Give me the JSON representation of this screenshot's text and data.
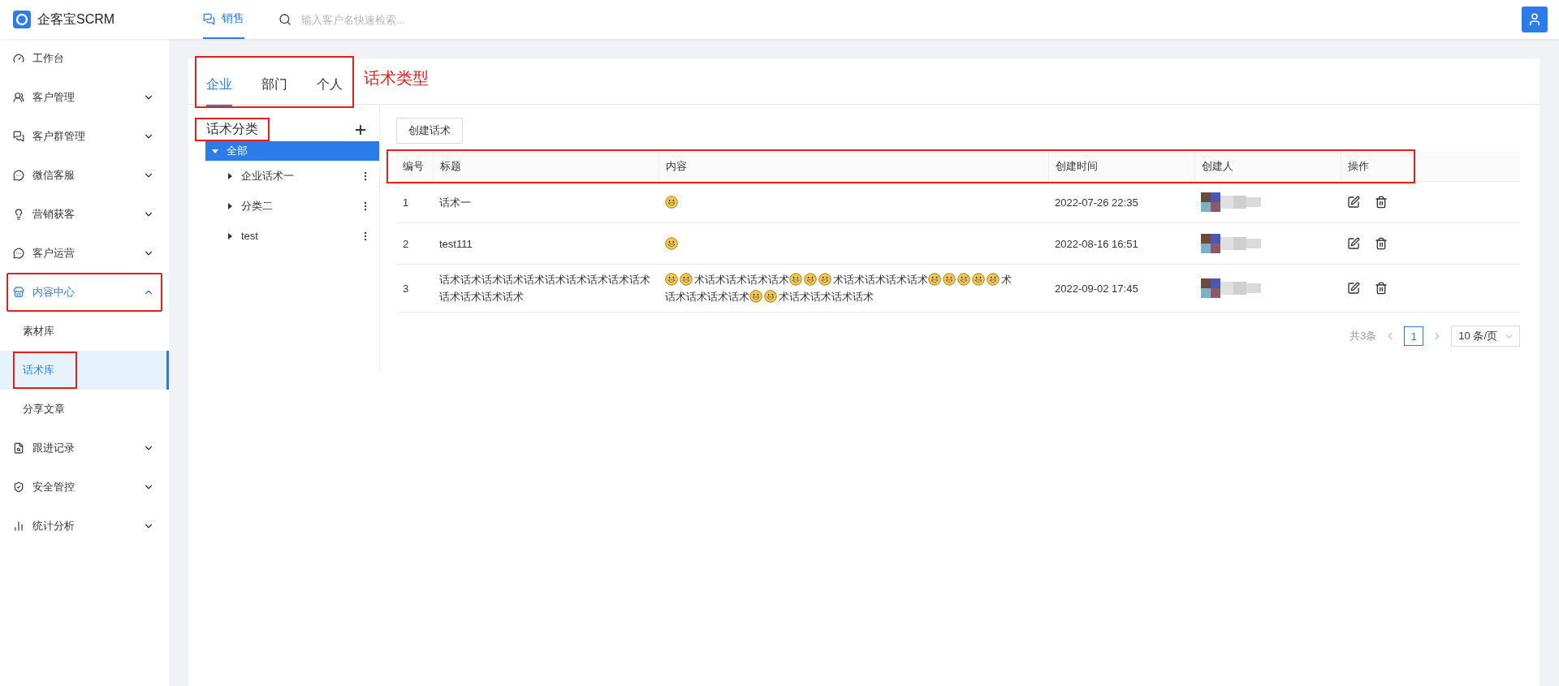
{
  "brand": {
    "name": "企客宝SCRM"
  },
  "top_nav": {
    "tabs": [
      {
        "label": "销售",
        "selected": true
      }
    ],
    "search": {
      "placeholder": "输入客户名快速检索..."
    }
  },
  "sidebar": {
    "items": [
      {
        "label": "工作台",
        "kind": "link",
        "selected": false,
        "highlighted": false
      },
      {
        "label": "客户管理",
        "kind": "group",
        "expanded": false,
        "selected": false,
        "highlighted": false
      },
      {
        "label": "客户群管理",
        "kind": "group",
        "expanded": false,
        "selected": false,
        "highlighted": false
      },
      {
        "label": "微信客服",
        "kind": "group",
        "expanded": false,
        "selected": false,
        "highlighted": false
      },
      {
        "label": "营销获客",
        "kind": "group",
        "expanded": false,
        "selected": false,
        "highlighted": false
      },
      {
        "label": "客户运营",
        "kind": "group",
        "expanded": false,
        "selected": false,
        "highlighted": false
      },
      {
        "label": "内容中心",
        "kind": "group",
        "expanded": true,
        "selected": true,
        "highlighted": true,
        "children": [
          {
            "label": "素材库",
            "selected": false,
            "highlighted": false
          },
          {
            "label": "话术库",
            "selected": true,
            "highlighted": true
          },
          {
            "label": "分享文章",
            "selected": false,
            "highlighted": false
          }
        ]
      },
      {
        "label": "跟进记录",
        "kind": "group",
        "expanded": false,
        "selected": false,
        "highlighted": false
      },
      {
        "label": "安全管控",
        "kind": "group",
        "expanded": false,
        "selected": false,
        "highlighted": false
      },
      {
        "label": "统计分析",
        "kind": "group",
        "expanded": false,
        "selected": false,
        "highlighted": false
      }
    ]
  },
  "type_tabs": {
    "highlighted": true,
    "annotation": "话术类型",
    "tabs": [
      {
        "label": "企业",
        "selected": true
      },
      {
        "label": "部门",
        "selected": false
      },
      {
        "label": "个人",
        "selected": false
      }
    ]
  },
  "category_tree": {
    "title": "话术分类",
    "highlighted": true,
    "nodes": [
      {
        "label": "全部",
        "selected": true,
        "expanded": true,
        "children": [
          {
            "label": "企业话术一",
            "selected": false,
            "expanded": false
          },
          {
            "label": "分类二",
            "selected": false,
            "expanded": false
          },
          {
            "label": "test",
            "selected": false,
            "expanded": false
          }
        ]
      }
    ]
  },
  "create_button": "创建话术",
  "table": {
    "header_highlighted": true,
    "columns": [
      "编号",
      "标题",
      "内容",
      "创建时间",
      "创建人",
      "操作"
    ],
    "rows": [
      {
        "id": "1",
        "title": "话术一",
        "content": [
          {
            "kind": "grin"
          }
        ],
        "created": "2022-07-26 22:35"
      },
      {
        "id": "2",
        "title": "test111",
        "content": [
          {
            "kind": "grin"
          }
        ],
        "created": "2022-08-16 16:51"
      },
      {
        "id": "3",
        "title": "话术话术话术话术话术话术话术话术话术话术话术话术话术话术",
        "content": [
          {
            "kind": "grin"
          },
          {
            "kind": "sweat"
          },
          {
            "kind": "text",
            "text": "术话术话术话术话术"
          },
          {
            "kind": "grin"
          },
          {
            "kind": "sweat"
          },
          {
            "kind": "grin"
          },
          {
            "kind": "text",
            "text": "术话术话术话术话术"
          },
          {
            "kind": "sweat"
          },
          {
            "kind": "grin"
          },
          {
            "kind": "sweat"
          },
          {
            "kind": "grin"
          },
          {
            "kind": "sweat"
          },
          {
            "kind": "text",
            "text": "术"
          },
          {
            "kind": "text",
            "text": "话术话术话术话术"
          },
          {
            "kind": "grin"
          },
          {
            "kind": "sweat"
          },
          {
            "kind": "text",
            "text": "术话术话术话术话术"
          }
        ],
        "created": "2022-09-02 17:45"
      }
    ]
  },
  "pagination": {
    "total": "共3条",
    "pages": [
      {
        "label": "1",
        "selected": true
      }
    ],
    "page_size": "10 条/页"
  }
}
